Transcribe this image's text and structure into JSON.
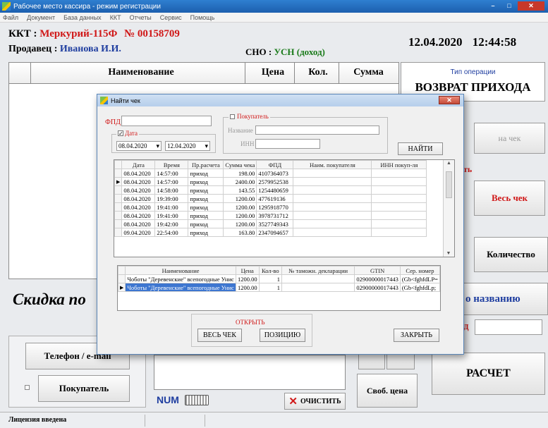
{
  "window": {
    "title": "Рабочее место кассира - режим регистрации",
    "minimize": "–",
    "maximize": "□",
    "close": "✕"
  },
  "menu": [
    "Файл",
    "Документ",
    "База данных",
    "ККТ",
    "Отчеты",
    "Сервис",
    "Помощь"
  ],
  "header": {
    "kkt_label": "ККТ :",
    "kkt_model": "Меркурий-115Ф",
    "kkt_number": "№ 00158709",
    "seller_label": "Продавец :",
    "seller_name": "Иванова И.И.",
    "sno_label": "СНО :",
    "sno_value": "УСН (доход)",
    "date": "12.04.2020",
    "time": "12:44:58"
  },
  "main_table": {
    "columns": [
      "Наименование",
      "Цена",
      "Кол.",
      "Сумма"
    ]
  },
  "right_panel": {
    "op_type_label": "Тип операции",
    "op_type_value": "ВОЗВРАТ ПРИХОДА",
    "on_check_button": "на чек",
    "partial_red": "ть",
    "whole_check_button": "Весь чек",
    "quantity_button": "Количество",
    "by_name_button": "о названию",
    "pay_button": "РАСЧЕТ",
    "small_btn_1": "",
    "small_btn_2": "",
    "red_field_label": "Д"
  },
  "left": {
    "discount_label": "Скидка по",
    "phone_button": "Телефон / e-mail",
    "buyer_button": "Покупатель",
    "num_label": "NUM",
    "clear_button": "ОЧИСТИТЬ",
    "free_price_button": "Своб. цена"
  },
  "status": {
    "license": "Лицензия введена"
  },
  "dialog": {
    "title": "Найти чек",
    "close": "✕",
    "fpd_label": "ФПД",
    "fpd_value": "",
    "date_label": "Дата",
    "date_from": "08.04.2020",
    "date_to": "12.04.2020",
    "buyer_label": "Покупатель",
    "name_label": "Название",
    "inn_label": "ИНН",
    "find_button": "НАЙТИ",
    "checks_columns": [
      "Дата",
      "Время",
      "Пр.расчета",
      "Сумма чека",
      "ФПД",
      "Наим. покупателя",
      "ИНН покуп-ля"
    ],
    "checks_rows": [
      [
        "08.04.2020",
        "14:57:00",
        "приход",
        "198.00",
        "4107364073",
        "",
        ""
      ],
      [
        "08.04.2020",
        "14:57:00",
        "приход",
        "2400.00",
        "2579952538",
        "",
        ""
      ],
      [
        "08.04.2020",
        "14:58:00",
        "приход",
        "143.55",
        "1254480659",
        "",
        ""
      ],
      [
        "08.04.2020",
        "19:39:00",
        "приход",
        "1200.00",
        "477619136",
        "",
        ""
      ],
      [
        "08.04.2020",
        "19:41:00",
        "приход",
        "1200.00",
        "1295918770",
        "",
        ""
      ],
      [
        "08.04.2020",
        "19:41:00",
        "приход",
        "1200.00",
        "3978731712",
        "",
        ""
      ],
      [
        "08.04.2020",
        "19:42:00",
        "приход",
        "1200.00",
        "3527749343",
        "",
        ""
      ],
      [
        "09.04.2020",
        "22:54:00",
        "приход",
        "163.80",
        "2347094657",
        "",
        ""
      ]
    ],
    "items_columns": [
      "Наименование",
      "Цена",
      "Кол-во",
      "№ таможн. декларации",
      "GTIN",
      "Сер. номер"
    ],
    "items_rows": [
      [
        "Чоботы \"Деревенские\" всепогодные Унис",
        "1200.00",
        "1",
        "",
        "02900000017443",
        "(Gb<fghfdLP="
      ],
      [
        "Чоботы \"Деревенские\" всепогодные Унис",
        "1200.00",
        "1",
        "",
        "02900000017443",
        "(Gb<fghfdLp;"
      ]
    ],
    "open_label": "ОТКРЫТЬ",
    "whole_check_button": "ВЕСЬ ЧЕК",
    "position_button": "ПОЗИЦИЮ",
    "close_button": "ЗАКРЫТЬ"
  }
}
